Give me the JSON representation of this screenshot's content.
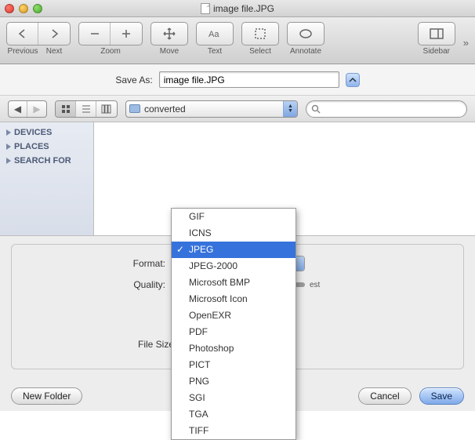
{
  "window": {
    "title": "image file.JPG"
  },
  "toolbar": {
    "previous": "Previous",
    "next": "Next",
    "zoom": "Zoom",
    "move": "Move",
    "text": "Text",
    "select": "Select",
    "annotate": "Annotate",
    "sidebar": "Sidebar"
  },
  "saveAs": {
    "label": "Save As:",
    "value": "image file.JPG"
  },
  "browser": {
    "folder": "converted",
    "search_placeholder": "",
    "search_value": ""
  },
  "sidebar": {
    "items": [
      {
        "label": "DEVICES"
      },
      {
        "label": "PLACES"
      },
      {
        "label": "SEARCH FOR"
      }
    ]
  },
  "options": {
    "format_label": "Format:",
    "quality_label": "Quality:",
    "quality_end": "est",
    "filesize_label": "File Size:"
  },
  "formatMenu": {
    "selected": "JPEG",
    "items": [
      "GIF",
      "ICNS",
      "JPEG",
      "JPEG-2000",
      "Microsoft BMP",
      "Microsoft Icon",
      "OpenEXR",
      "PDF",
      "Photoshop",
      "PICT",
      "PNG",
      "SGI",
      "TGA",
      "TIFF"
    ]
  },
  "buttons": {
    "newFolder": "New Folder",
    "cancel": "Cancel",
    "save": "Save"
  }
}
